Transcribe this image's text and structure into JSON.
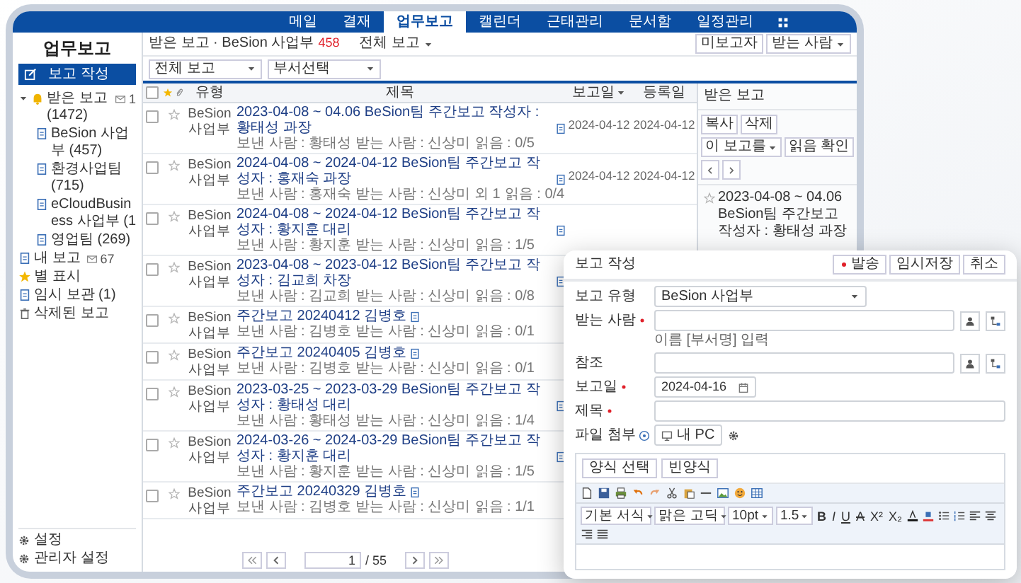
{
  "nav": {
    "tabs": [
      {
        "label": "메일",
        "selected": false
      },
      {
        "label": "결재",
        "selected": false
      },
      {
        "label": "업무보고",
        "selected": true
      },
      {
        "label": "캘린더",
        "selected": false
      },
      {
        "label": "근태관리",
        "selected": false
      },
      {
        "label": "문서함",
        "selected": false
      },
      {
        "label": "일정관리",
        "selected": false
      }
    ]
  },
  "sidebar": {
    "title": "업무보고",
    "compose_button": "보고 작성",
    "items": [
      {
        "label": "받은 보고 (1472)",
        "kind": "inbox",
        "badge": "1",
        "expanded": true,
        "children": [
          {
            "label": "BeSion 사업부 (457)",
            "kind": "doc"
          },
          {
            "label": "환경사업팀 (715)",
            "kind": "doc"
          },
          {
            "label": "eCloudBusiness 사업부 (1",
            "kind": "doc"
          },
          {
            "label": "영업팀 (269)",
            "kind": "doc"
          }
        ]
      },
      {
        "label": "내 보고",
        "kind": "doc",
        "badge": "67"
      },
      {
        "label": "별 표시",
        "kind": "star"
      },
      {
        "label": "임시 보관 (1)",
        "kind": "doc"
      },
      {
        "label": "삭제된 보고",
        "kind": "trash"
      }
    ],
    "footer": [
      "설정",
      "관리자 설정"
    ]
  },
  "list": {
    "breadcrumb": "받은 보고 · BeSion 사업부",
    "count": "458",
    "view_menu": "전체 보고",
    "header_buttons": [
      {
        "label": "미보고자",
        "has_menu": false
      },
      {
        "label": "받는 사람",
        "has_menu": true
      }
    ],
    "filters": [
      "전체 보고",
      "부서선택"
    ],
    "select_all_checked": false,
    "columns": [
      {
        "label": "유형",
        "sorted": false
      },
      {
        "label": "제목",
        "sorted": false
      },
      {
        "label": "보고일",
        "sorted": true
      },
      {
        "label": "등록일",
        "sorted": false
      }
    ],
    "rows": [
      {
        "type": "BeSion 사업부",
        "title": "2023-04-08 ~ 04.06 BeSion팀 주간보고 작성자 : 황태성 과장",
        "sender": "보낸 사람 : 황태성",
        "receivers": "받는 사람 : 신상미",
        "read": "읽음 : 0/5",
        "reported": "2024-04-12",
        "registered": "2024-04-12",
        "checked": false,
        "starred": false
      },
      {
        "type": "BeSion 사업부",
        "title": "2024-04-08 ~ 2024-04-12 BeSion팀 주간보고 작성자 : 홍재숙 과장",
        "sender": "보낸 사람 : 홍재숙",
        "receivers": "받는 사람 : 신상미 외 1",
        "read": "읽음 : 0/4",
        "reported": "2024-04-12",
        "registered": "2024-04-12",
        "checked": false,
        "starred": false
      },
      {
        "type": "BeSion 사업부",
        "title": "2024-04-08 ~ 2024-04-12 BeSion팀 주간보고 작성자 : 황지훈 대리",
        "sender": "보낸 사람 : 황지훈",
        "receivers": "받는 사람 : 신상미",
        "read": "읽음 : 1/5",
        "checked": false,
        "starred": false
      },
      {
        "type": "BeSion 사업부",
        "title": "2023-04-08 ~ 2023-04-12 BeSion팀 주간보고 작성자 : 김교희 차장",
        "sender": "보낸 사람 : 김교희",
        "receivers": "받는 사람 : 신상미",
        "read": "읽음 : 0/8",
        "checked": false,
        "starred": false
      },
      {
        "type": "BeSion 사업부",
        "title": "주간보고 20240412 김병호",
        "sender": "보낸 사람 : 김병호",
        "receivers": "받는 사람 : 신상미",
        "read": "읽음 : 0/1",
        "checked": false,
        "starred": false
      },
      {
        "type": "BeSion 사업부",
        "title": "주간보고 20240405 김병호",
        "sender": "보낸 사람 : 김병호",
        "receivers": "받는 사람 : 신상미",
        "read": "읽음 : 0/1",
        "checked": false,
        "starred": false
      },
      {
        "type": "BeSion 사업부",
        "title": "2023-03-25 ~ 2023-03-29 BeSion팀 주간보고 작성자 : 황태성 대리",
        "sender": "보낸 사람 : 황태성",
        "receivers": "받는 사람 : 신상미",
        "read": "읽음 : 1/4",
        "checked": false,
        "starred": false
      },
      {
        "type": "BeSion 사업부",
        "title": "2024-03-26 ~ 2024-03-29 BeSion팀 주간보고 작성자 : 황지훈 대리",
        "sender": "보낸 사람 : 황지훈",
        "receivers": "받는 사람 : 신상미",
        "read": "읽음 : 1/5",
        "checked": false,
        "starred": false
      },
      {
        "type": "BeSion 사업부",
        "title": "주간보고 20240329 김병호",
        "sender": "보낸 사람 : 김병호",
        "receivers": "받는 사람 : 신상미",
        "read": "읽음 : 1/1",
        "checked": false,
        "starred": false
      }
    ],
    "pagination": {
      "page": "1",
      "total": "/ 55"
    }
  },
  "preview": {
    "title": "받은 보고",
    "buttons": [
      {
        "label": "복사",
        "has_menu": false
      },
      {
        "label": "삭제",
        "has_menu": false
      },
      {
        "label": "이 보고를",
        "has_menu": true
      },
      {
        "label": "읽음 확인",
        "has_menu": false
      }
    ],
    "item": {
      "title": "2023-04-08 ~ 04.06 BeSion팀 주간보고 작성자 : 황태성 과장",
      "starred": false
    }
  },
  "form": {
    "title": "보고 작성",
    "actions": [
      {
        "label": "발송",
        "kind": "send"
      },
      {
        "label": "임시저장",
        "kind": "plain"
      },
      {
        "label": "취소",
        "kind": "plain"
      }
    ],
    "fields": [
      {
        "label": "보고 유형",
        "kind": "select",
        "value": "BeSion 사업부",
        "required": false
      },
      {
        "label": "받는 사람",
        "kind": "people",
        "required": true,
        "hint": "이름 [부서명] 입력"
      },
      {
        "label": "참조",
        "kind": "people",
        "required": false
      },
      {
        "label": "보고일",
        "kind": "date",
        "value": "2024-04-16",
        "required": true
      },
      {
        "label": "제목",
        "kind": "text",
        "required": true
      },
      {
        "label": "파일 첨부",
        "kind": "file",
        "button": "내 PC",
        "required": false
      }
    ],
    "editor": {
      "template_buttons": [
        "양식 선택",
        "빈양식"
      ],
      "style_selects": [
        "기본 서식",
        "맑은 고딕",
        "10pt",
        "1.5"
      ],
      "format_buttons": [
        "B",
        "I",
        "U",
        "A",
        "X²",
        "X₂"
      ]
    }
  }
}
